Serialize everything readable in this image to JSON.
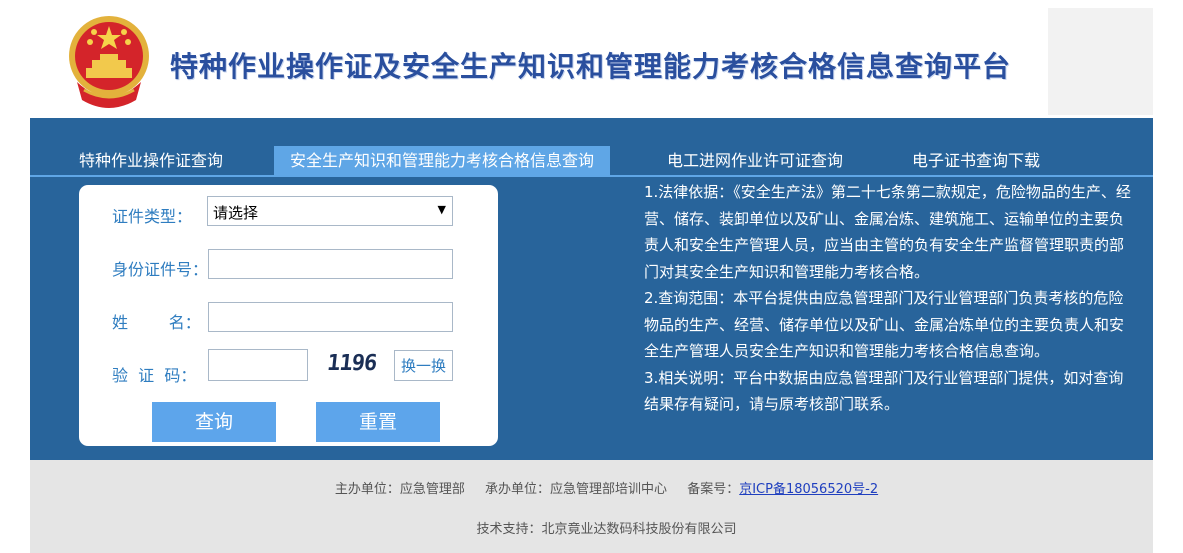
{
  "header": {
    "title": "特种作业操作证及安全生产知识和管理能力考核合格信息查询平台",
    "emblem_icon": "national-emblem-icon"
  },
  "tabs": [
    {
      "label": "特种作业操作证查询",
      "active": false
    },
    {
      "label": "安全生产知识和管理能力考核合格信息查询",
      "active": true
    },
    {
      "label": "电工进网作业许可证查询",
      "active": false
    },
    {
      "label": "电子证书查询下载",
      "active": false
    }
  ],
  "form": {
    "cert_type_label": "证件类型：",
    "cert_type_value": "请选择",
    "id_label": "身份证件号：",
    "id_value": "",
    "name_label": "姓        名：",
    "name_value": "",
    "captcha_label": "验  证  码：",
    "captcha_value": "",
    "captcha_image_text": "1196",
    "refresh_label": "换一换",
    "query_label": "查询",
    "reset_label": "重置"
  },
  "notes": [
    "1.法律依据：《安全生产法》第二十七条第二款规定，危险物品的生产、经营、储存、装卸单位以及矿山、金属冶炼、建筑施工、运输单位的主要负责人和安全生产管理人员，应当由主管的负有安全生产监督管理职责的部门对其安全生产知识和管理能力考核合格。",
    "2.查询范围：本平台提供由应急管理部门及行业管理部门负责考核的危险物品的生产、经营、储存单位以及矿山、金属冶炼单位的主要负责人和安全生产管理人员安全生产知识和管理能力考核合格信息查询。",
    "3.相关说明：平台中数据由应急管理部门及行业管理部门提供，如对查询结果存有疑问，请与原考核部门联系。"
  ],
  "footer": {
    "sponsor": "主办单位：应急管理部",
    "organizer": "承办单位：应急管理部培训中心",
    "icp_label": "备案号：",
    "icp_link": "京ICP备18056520号-2",
    "tech_support": "技术支持：北京竟业达数码科技股份有限公司"
  },
  "colors": {
    "band": "#28649b",
    "tab_active": "#5fa6e6",
    "button": "#5da5eb",
    "title": "#2a4f9e",
    "label": "#2f7dc0"
  }
}
